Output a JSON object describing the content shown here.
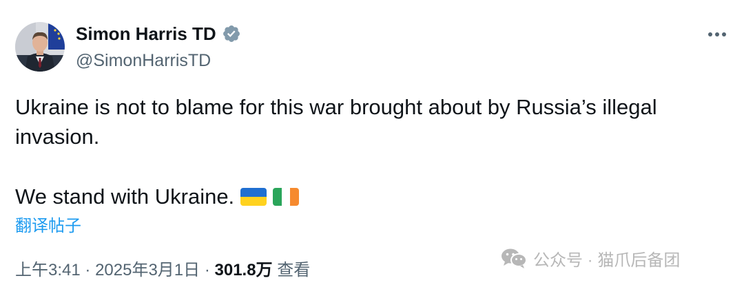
{
  "author": {
    "display_name": "Simon Harris TD",
    "handle": "@SimonHarrisTD",
    "verified_icon": "verified-badge-icon",
    "verified_color": "#829aab"
  },
  "post": {
    "line1": "Ukraine is not to blame for this war brought about by Russia’s illegal invasion.",
    "line2": "We stand with Ukraine.",
    "flags": [
      "ukraine-flag",
      "ireland-flag"
    ]
  },
  "translate_label": "翻译帖子",
  "meta": {
    "time": "上午3:41",
    "separator": "·",
    "date": "2025年3月1日",
    "views_count": "301.8万",
    "views_label": "查看"
  },
  "watermark": {
    "icon": "wechat-icon",
    "text": "公众号 · 猫爪后备团"
  },
  "colors": {
    "text": "#0f1419",
    "secondary": "#536471",
    "link": "#1d9bf0",
    "watermark": "#b7b7b7"
  }
}
